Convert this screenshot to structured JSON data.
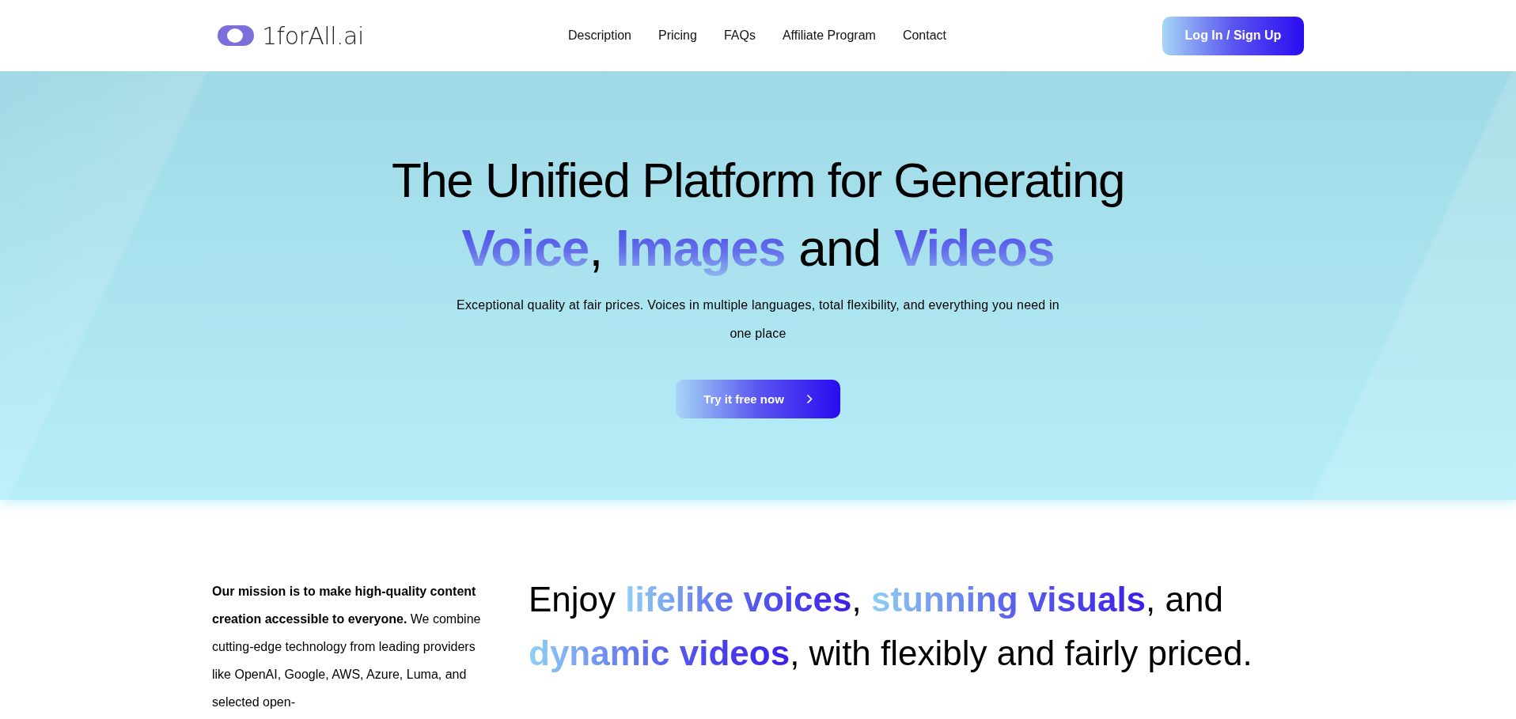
{
  "header": {
    "logo_text": "1forAll.ai",
    "nav": [
      {
        "label": "Description"
      },
      {
        "label": "Pricing"
      },
      {
        "label": "FAQs"
      },
      {
        "label": "Affiliate Program"
      },
      {
        "label": "Contact"
      }
    ],
    "login_button": "Log In / Sign Up"
  },
  "hero": {
    "title_line1": "The Unified Platform for Generating",
    "title_line2": [
      {
        "text": "Voice",
        "kind": "gradient"
      },
      {
        "text": ", ",
        "kind": "plain"
      },
      {
        "text": "Images",
        "kind": "gradient"
      },
      {
        "text": " and ",
        "kind": "plain"
      },
      {
        "text": "Videos",
        "kind": "gradient"
      }
    ],
    "subtitle": "Exceptional quality at fair prices. Voices in multiple languages, total flexibility, and everything you need in one place",
    "cta_button": "Try it free now"
  },
  "mission": {
    "text": "**Our mission is to make high-quality content creation accessible to everyone.** We combine cutting-edge technology from leading providers like OpenAI, Google, AWS, Azure, Luma, and selected open-",
    "headline": [
      {
        "text": "Enjoy ",
        "kind": "plain"
      },
      {
        "text": "lifelike voices",
        "kind": "gradient"
      },
      {
        "text": ", ",
        "kind": "plain"
      },
      {
        "text": "stunning visuals",
        "kind": "gradient"
      },
      {
        "text": ", and ",
        "kind": "plain"
      },
      {
        "text": "dynamic videos",
        "kind": "gradient"
      },
      {
        "text": ", with flexibly and fairly priced.",
        "kind": "plain"
      }
    ]
  }
}
